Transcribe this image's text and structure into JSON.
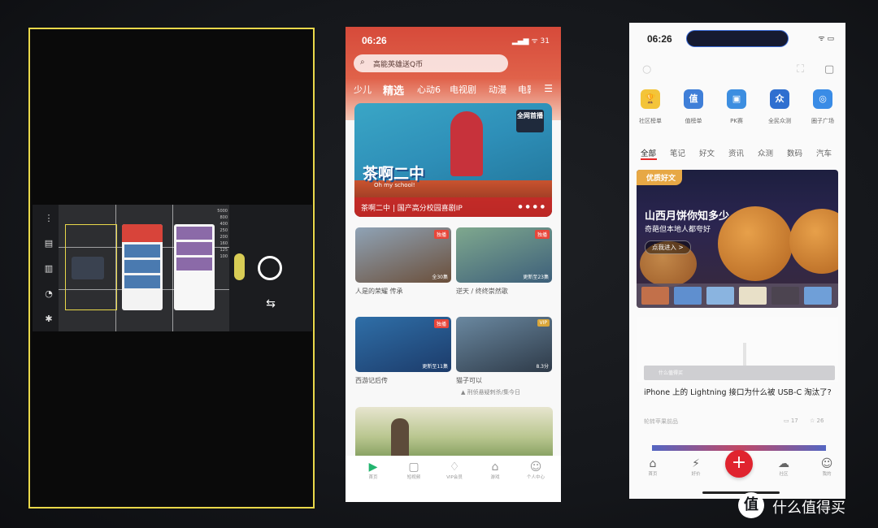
{
  "camera": {
    "ruler_labels": [
      "5000",
      "800",
      "400",
      "250",
      "200",
      "160",
      "125",
      "100"
    ]
  },
  "video_app": {
    "status": {
      "time": "06:26",
      "battery": "31"
    },
    "search_placeholder": "高能英雄送Q币",
    "tabs": [
      "少儿",
      "精选",
      "心动6",
      "电视剧",
      "动漫",
      "电影"
    ],
    "selected_tab": "精选",
    "banner": {
      "title_art": "茶啊二中",
      "title_en": "Oh my school!",
      "badge": "全网首播",
      "caption": "茶啊二中 | 国产高分校园喜剧IP"
    },
    "cards": [
      {
        "title": "人是的荣耀 传承",
        "badge": "独播",
        "episode": "全30集",
        "sub": ""
      },
      {
        "title": "逆天 / 终终崇然歌",
        "badge": "独播",
        "episode": "更新至23集",
        "sub": ""
      },
      {
        "title": "西游记后传",
        "badge": "独播",
        "episode": "更新至11集",
        "sub": ""
      },
      {
        "title": "猫子可以",
        "badge": "VIP",
        "episode": "8.3分",
        "sub": "▲ 刑侦悬疑刺杀/集今日"
      }
    ],
    "nav": [
      {
        "label": "首页",
        "icon": "▶"
      },
      {
        "label": "短视频",
        "icon": "▢"
      },
      {
        "label": "VIP会员",
        "icon": "♢"
      },
      {
        "label": "游戏",
        "icon": "⌂"
      },
      {
        "label": "个人中心",
        "icon": "☺"
      }
    ]
  },
  "smzdm_app": {
    "status": {
      "time": "06:26"
    },
    "quick_links": [
      {
        "label": "社区榜单",
        "icon": "🏆"
      },
      {
        "label": "值榜单",
        "icon": "值"
      },
      {
        "label": "PK赛",
        "icon": "▣"
      },
      {
        "label": "全民众测",
        "icon": "众"
      },
      {
        "label": "圈子广场",
        "icon": "◎"
      }
    ],
    "tabs": [
      "全部",
      "笔记",
      "好文",
      "资讯",
      "众测",
      "数码",
      "汽车"
    ],
    "selected_tab": "全部",
    "featured": {
      "chip": "优质好文",
      "headline": "山西月饼你知多少",
      "subline": "奇葩但本地人都夸好",
      "button": "点我进入 >"
    },
    "article": {
      "band_label": "什么值得买",
      "title": "iPhone 上的 Lightning 接口为什么被 USB-C 淘汰了?",
      "author": "轮转苹果前品",
      "comments": "17",
      "likes": "26"
    },
    "nav": [
      {
        "label": "首页",
        "icon": "⌂"
      },
      {
        "label": "好价",
        "icon": "⚡"
      },
      {
        "label": "社区",
        "icon": "☁"
      },
      {
        "label": "我的",
        "icon": "☺"
      }
    ],
    "fab": "+"
  },
  "watermark": {
    "logo": "值",
    "text": "什么值得买"
  }
}
